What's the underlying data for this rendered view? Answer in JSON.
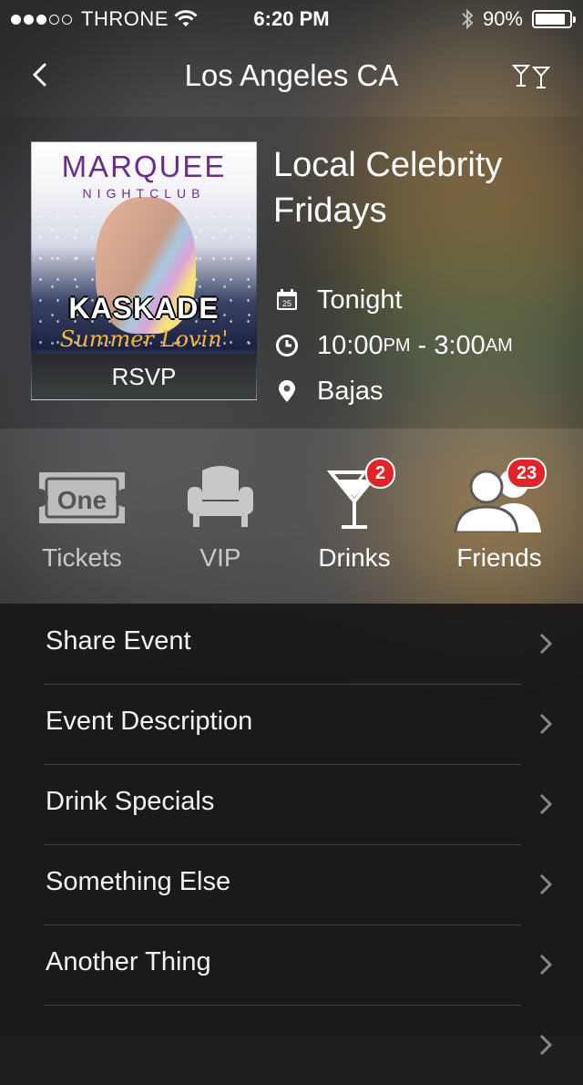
{
  "status_bar": {
    "carrier": "THRONE",
    "signal_dots_filled": 3,
    "signal_dots_total": 5,
    "time": "6:20 PM",
    "battery_percent": "90%",
    "battery_level": 0.9
  },
  "nav": {
    "title": "Los Angeles CA",
    "back_icon": "chevron-left-icon",
    "right_icon": "cocktail-glasses-icon"
  },
  "event": {
    "title": "Local Celebrity Fridays",
    "poster": {
      "club_name": "MARQUEE",
      "club_sub": "NIGHTCLUB",
      "artist": "KASKADE",
      "script_text": "Summer Lovin'",
      "rsvp_label": "RSVP"
    },
    "date": "Tonight",
    "time_start": "10:00",
    "time_start_suffix": "PM",
    "time_separator": " - ",
    "time_end": "3:00",
    "time_end_suffix": "AM",
    "venue": "Bajas",
    "calendar_icon_day": "25"
  },
  "actions": [
    {
      "label": "Tickets",
      "icon": "ticket-icon",
      "ticket_text": "One",
      "badge": null
    },
    {
      "label": "VIP",
      "icon": "armchair-icon",
      "badge": null
    },
    {
      "label": "Drinks",
      "icon": "martini-icon",
      "badge": "2"
    },
    {
      "label": "Friends",
      "icon": "people-icon",
      "badge": "23"
    }
  ],
  "menu": [
    {
      "label": "Share Event"
    },
    {
      "label": "Event Description"
    },
    {
      "label": "Drink Specials"
    },
    {
      "label": "Something Else"
    },
    {
      "label": "Another Thing"
    }
  ],
  "colors": {
    "badge": "#e3232a",
    "poster_brand": "#6b2d89",
    "list_background": "#1a1a1a"
  }
}
